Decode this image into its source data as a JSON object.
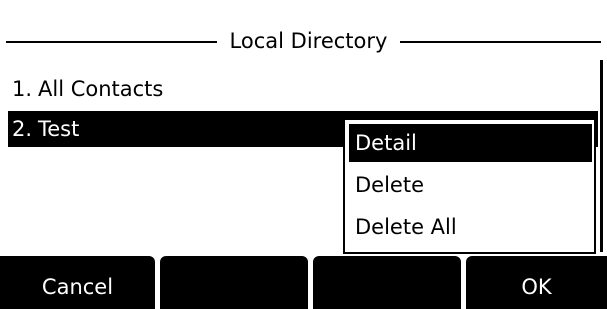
{
  "header": {
    "title": "Local Directory"
  },
  "list": {
    "items": [
      {
        "number": "1.",
        "label": "All Contacts",
        "selected": false
      },
      {
        "number": "2.",
        "label": "Test",
        "selected": true
      }
    ]
  },
  "popup_menu": {
    "items": [
      {
        "label": "Detail",
        "highlighted": true
      },
      {
        "label": "Delete",
        "highlighted": false
      },
      {
        "label": "Delete All",
        "highlighted": false
      }
    ]
  },
  "softkeys": [
    {
      "label": "Cancel"
    },
    {
      "label": ""
    },
    {
      "label": ""
    },
    {
      "label": "OK"
    }
  ],
  "colors": {
    "background": "#ffffff",
    "foreground": "#000000",
    "highlight_bg": "#000000",
    "highlight_fg": "#ffffff"
  }
}
